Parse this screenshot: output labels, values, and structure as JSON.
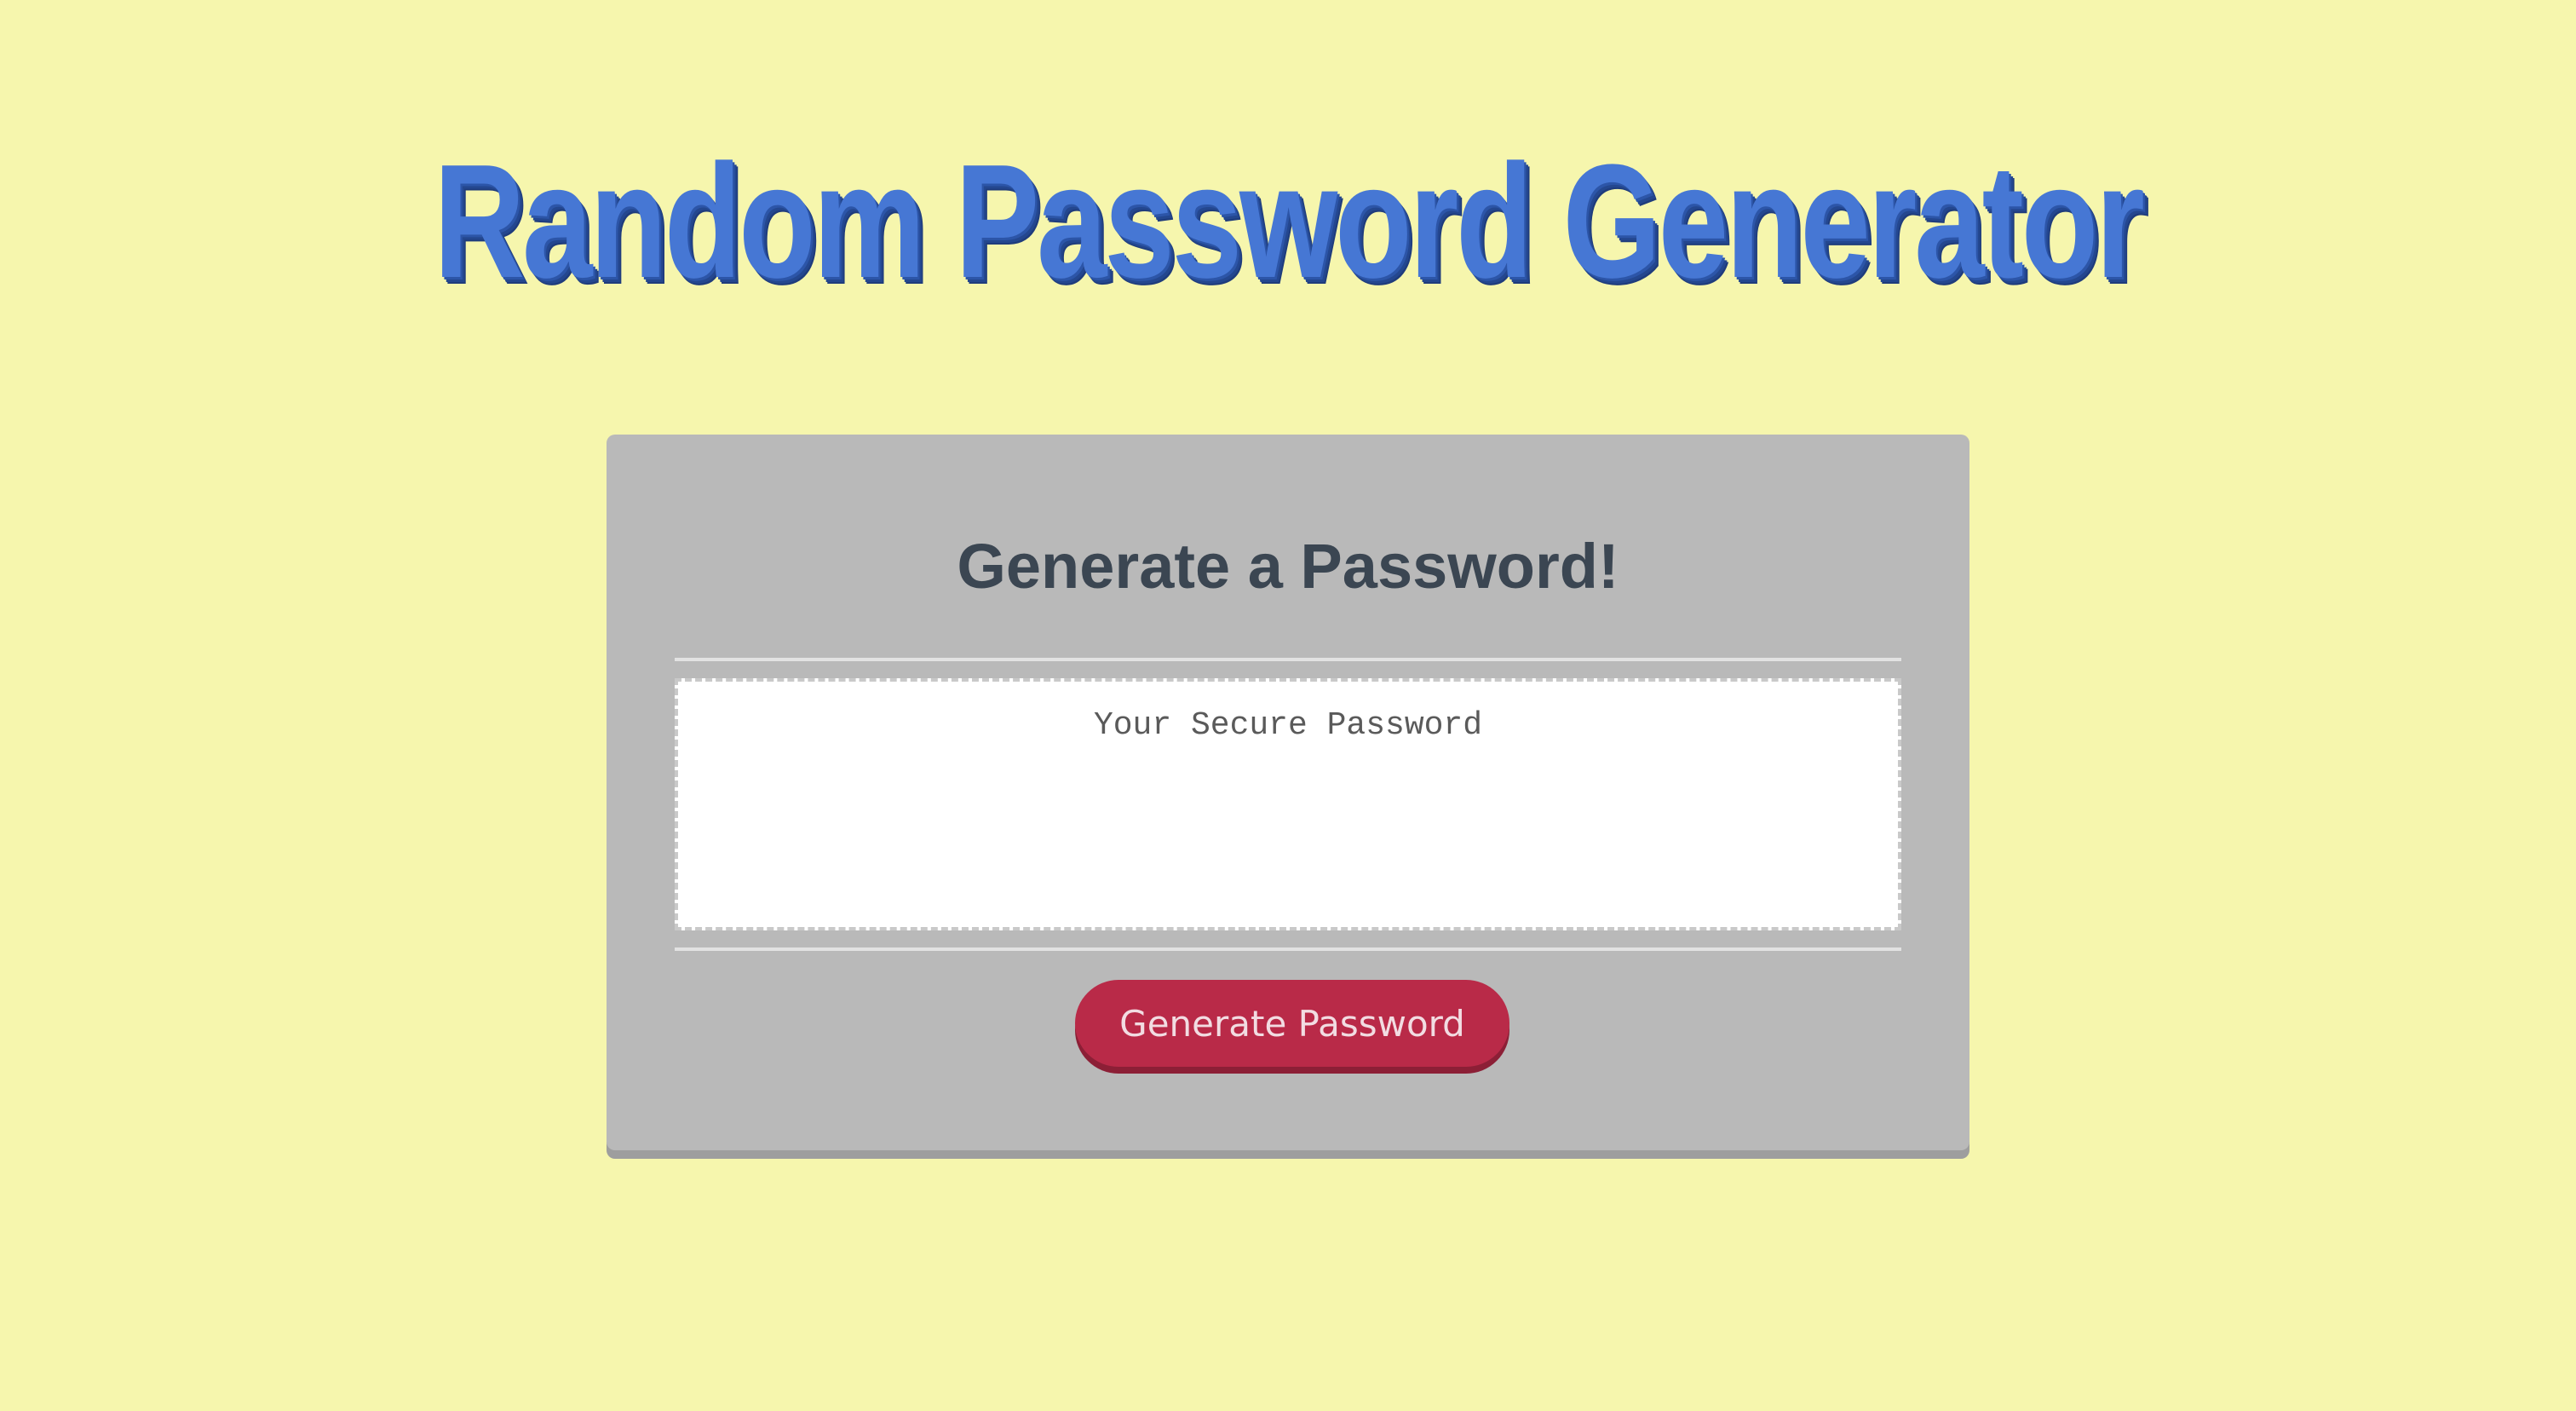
{
  "app": {
    "title": "Random Password Generator"
  },
  "card": {
    "header": "Generate a Password!",
    "password_field": {
      "value": "",
      "placeholder": "Your Secure Password"
    },
    "generate_button_label": "Generate Password"
  },
  "colors": {
    "background": "#f6f6ad",
    "title": "#4677d4",
    "card": "#b9b9b9",
    "button": "#b92a48"
  }
}
